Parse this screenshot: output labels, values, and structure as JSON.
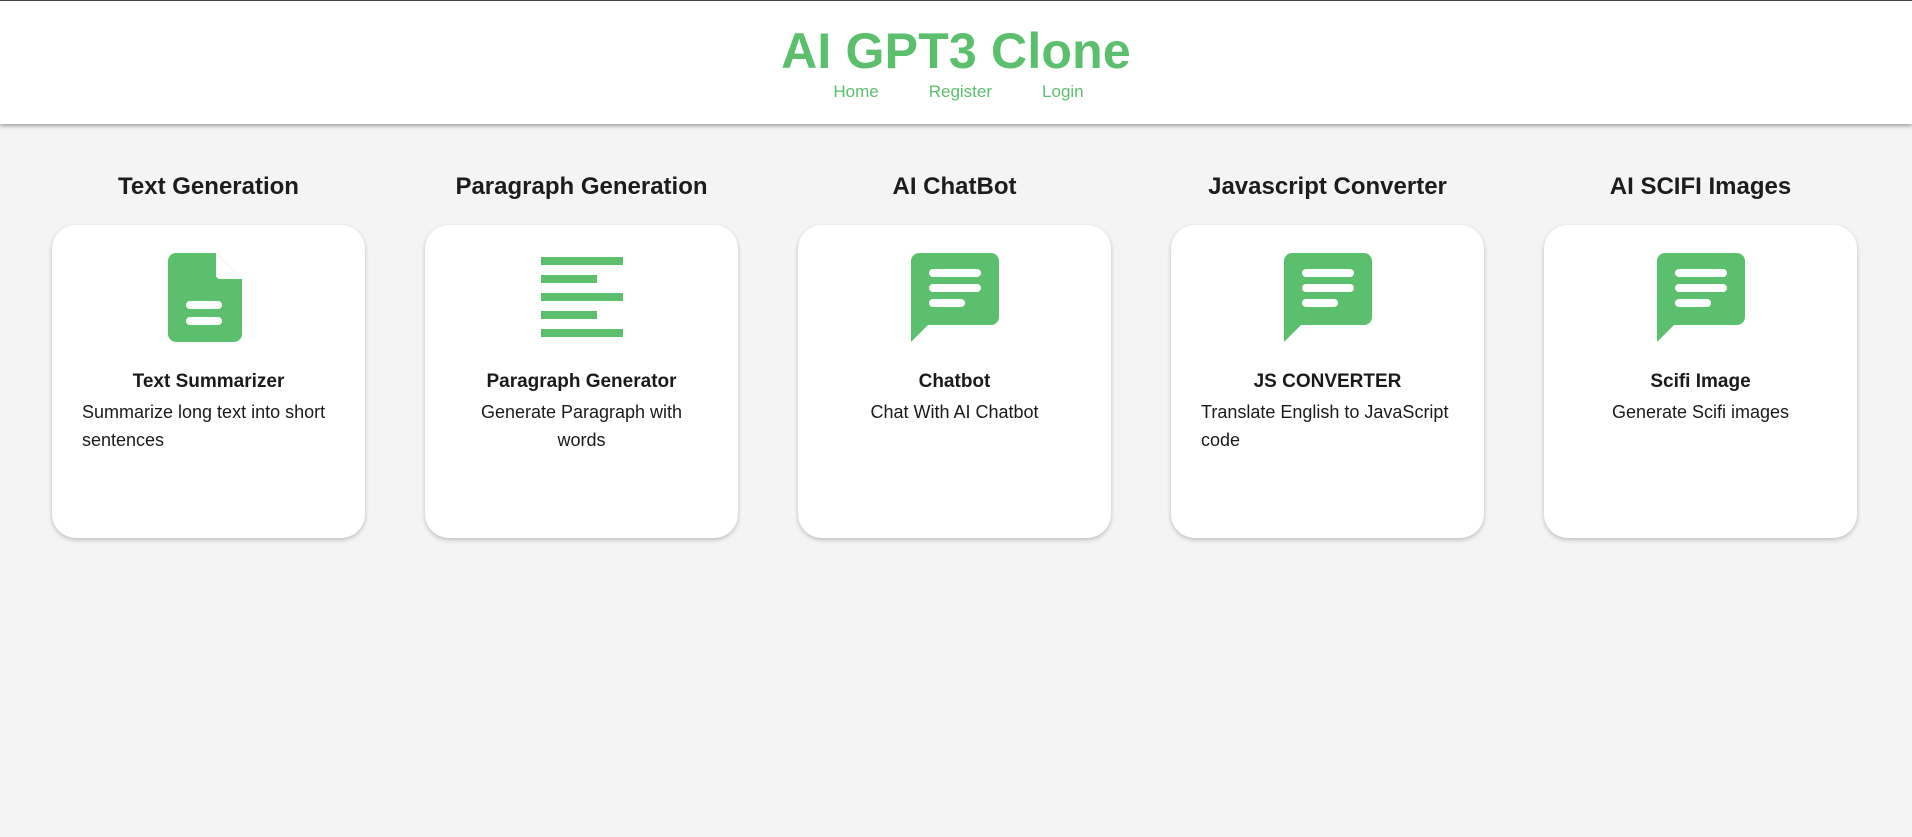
{
  "header": {
    "title": "AI GPT3 Clone",
    "nav": [
      {
        "label": "Home"
      },
      {
        "label": "Register"
      },
      {
        "label": "Login"
      }
    ]
  },
  "colors": {
    "accent": "#5cbf6d",
    "background": "#f4f4f4",
    "card": "#ffffff"
  },
  "sections": [
    {
      "heading": "Text Generation",
      "card_title": "Text Summarizer",
      "card_desc": "Summarize long text into short sentences",
      "icon": "document-icon"
    },
    {
      "heading": "Paragraph Generation",
      "card_title": "Paragraph Generator",
      "card_desc": "Generate Paragraph with words",
      "icon": "align-left-icon"
    },
    {
      "heading": "AI ChatBot",
      "card_title": "Chatbot",
      "card_desc": "Chat With AI Chatbot",
      "icon": "chat-icon"
    },
    {
      "heading": "Javascript Converter",
      "card_title": "JS CONVERTER",
      "card_desc": "Translate English to JavaScript code",
      "icon": "chat-icon"
    },
    {
      "heading": "AI SCIFI Images",
      "card_title": "Scifi Image",
      "card_desc": "Generate Scifi images",
      "icon": "chat-icon"
    }
  ]
}
